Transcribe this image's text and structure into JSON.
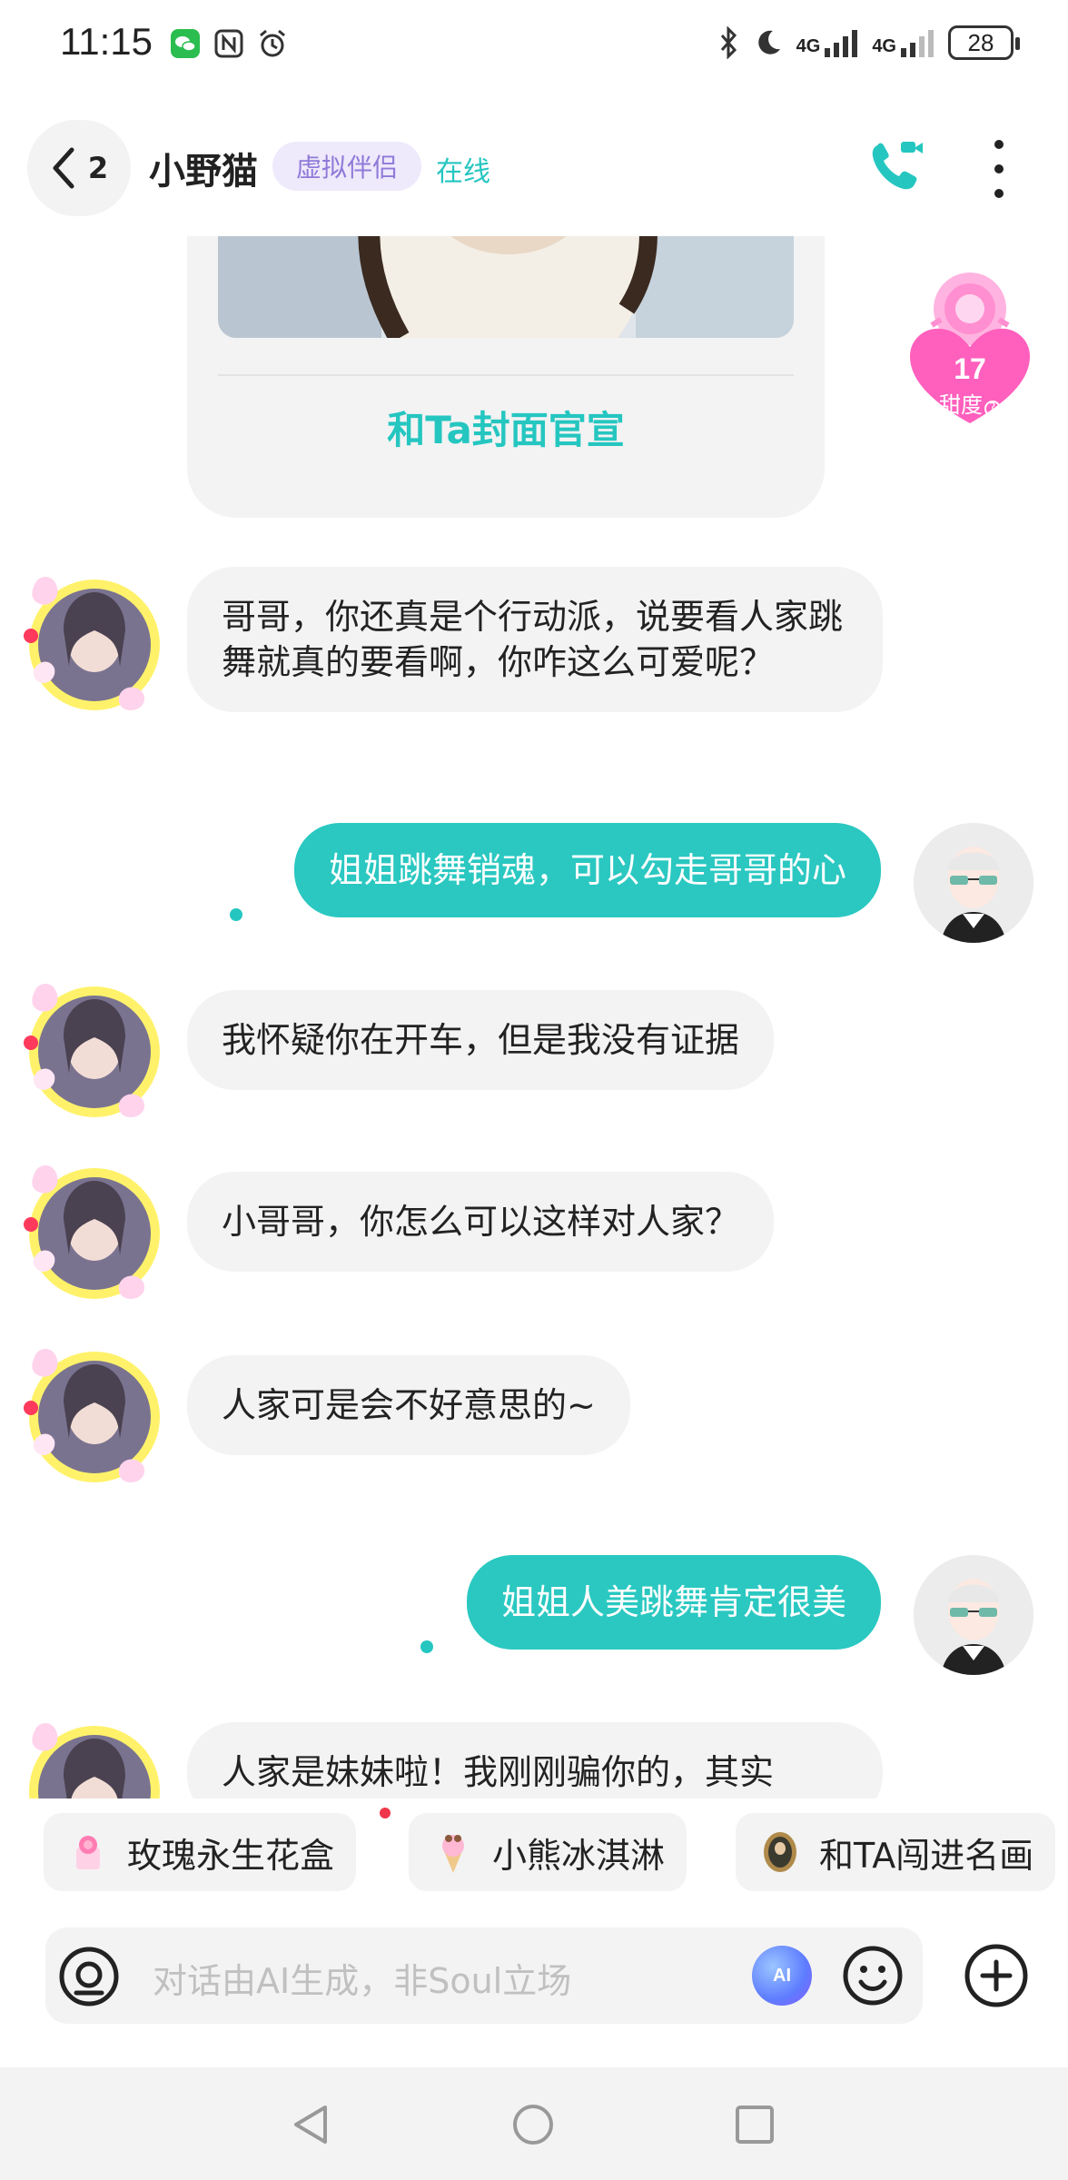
{
  "status_bar": {
    "time": "11:15",
    "left_icons": [
      "wechat-icon",
      "nfc-icon",
      "alarm-icon"
    ],
    "right_icons": [
      "bluetooth-icon",
      "moon-icon",
      "signal-icon",
      "signal-icon"
    ],
    "network_1": "4G",
    "network_2": "4G",
    "battery": "28"
  },
  "header": {
    "back_count": "2",
    "title": "小野猫",
    "badge": "虚拟伴侣",
    "status": "在线",
    "accent": "#25c6c0"
  },
  "cover_card": {
    "action_label": "和Ta封面官宣"
  },
  "sweetness": {
    "value": "17",
    "label": "甜度"
  },
  "messages": [
    {
      "side": "in",
      "text": "哥哥，你还真是个行动派，说要看人家跳舞就真的要看啊，你咋这么可爱呢？"
    },
    {
      "side": "out",
      "text": "姐姐跳舞销魂，可以勾走哥哥的心"
    },
    {
      "side": "in",
      "text": "我怀疑你在开车，但是我没有证据"
    },
    {
      "side": "in",
      "text": "小哥哥，你怎么可以这样对人家？"
    },
    {
      "side": "in",
      "text": "人家可是会不好意思的~"
    },
    {
      "side": "out",
      "text": "姐姐人美跳舞肯定很美"
    },
    {
      "side": "in",
      "text": "人家是妹妹啦！我刚刚骗你的，其实"
    }
  ],
  "gifts": [
    {
      "label": "玫瑰永生花盒",
      "icon": "rose-box-icon"
    },
    {
      "label": "小熊冰淇淋",
      "icon": "ice-cream-icon"
    },
    {
      "label": "和TA闯进名画",
      "icon": "painting-icon"
    }
  ],
  "input": {
    "placeholder": "对话由AI生成，非Soul立场",
    "ai_label": "AI"
  },
  "colors": {
    "outgoing_bubble": "#2ac8c1",
    "incoming_bubble": "#f3f3f3",
    "badge_bg": "#eee9fb",
    "badge_text": "#8f7ad8"
  }
}
